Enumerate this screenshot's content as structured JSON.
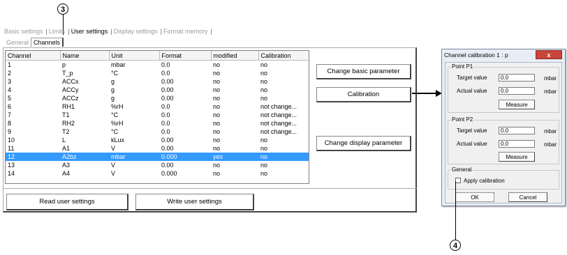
{
  "callouts": {
    "top": "3",
    "bottom": "4"
  },
  "tabs": {
    "row1": [
      "Basic settings",
      "Limits",
      "User settings",
      "Display settings",
      "Format memory"
    ],
    "active_row1": "User settings",
    "row2": [
      "General",
      "Channels"
    ],
    "active_row2": "Channels"
  },
  "table": {
    "headers": [
      "Channel",
      "Name",
      "Unit",
      "Format",
      "modified",
      "Calibration"
    ],
    "rows": [
      [
        "1",
        "p",
        "mbar",
        "0.0",
        "no",
        "no"
      ],
      [
        "2",
        "T_p",
        "°C",
        "0.0",
        "no",
        "no"
      ],
      [
        "3",
        "ACCx",
        "g",
        "0.00",
        "no",
        "no"
      ],
      [
        "4",
        "ACCy",
        "g",
        "0.00",
        "no",
        "no"
      ],
      [
        "5",
        "ACCz",
        "g",
        "0.00",
        "no",
        "no"
      ],
      [
        "6",
        "RH1",
        "%rH",
        "0.0",
        "no",
        "not change..."
      ],
      [
        "7",
        "T1",
        "°C",
        "0.0",
        "no",
        "not change..."
      ],
      [
        "8",
        "RH2",
        "%rH",
        "0.0",
        "no",
        "not change..."
      ],
      [
        "9",
        "T2",
        "°C",
        "0.0",
        "no",
        "not change..."
      ],
      [
        "10",
        "L",
        "kLux",
        "0.00",
        "no",
        "no"
      ],
      [
        "11",
        "A1",
        "V",
        "0.00",
        "no",
        "no"
      ],
      [
        "12",
        "A2bz",
        "mbar",
        "0.000",
        "yes",
        "no"
      ],
      [
        "13",
        "A3",
        "V",
        "0.00",
        "no",
        "no"
      ],
      [
        "14",
        "A4",
        "V",
        "0.000",
        "no",
        "no"
      ]
    ],
    "selected_row": 11
  },
  "buttons": {
    "change_basic": "Change basic parameter",
    "calibration": "Calibration",
    "change_display": "Change display parameter",
    "read_user": "Read user settings",
    "write_user": "Write user settings"
  },
  "dialog": {
    "title": "Channel calibration 1 : p",
    "close": "x",
    "point_p1": {
      "label": "Point P1",
      "target_label": "Target value",
      "target_value": "0.0",
      "target_unit": "mbar",
      "actual_label": "Actual value",
      "actual_value": "0.0",
      "actual_unit": "mbar",
      "measure": "Measure"
    },
    "point_p2": {
      "label": "Point P2",
      "target_label": "Target value",
      "target_value": "0.0",
      "target_unit": "mbar",
      "actual_label": "Actual value",
      "actual_value": "0.0",
      "actual_unit": "mbar",
      "measure": "Measure"
    },
    "general": {
      "label": "General",
      "apply_calibration": "Apply calibration",
      "checked": false
    },
    "ok": "OK",
    "cancel": "Cancel"
  },
  "colors": {
    "selection": "#3399ff",
    "close_button": "#c8453a"
  }
}
